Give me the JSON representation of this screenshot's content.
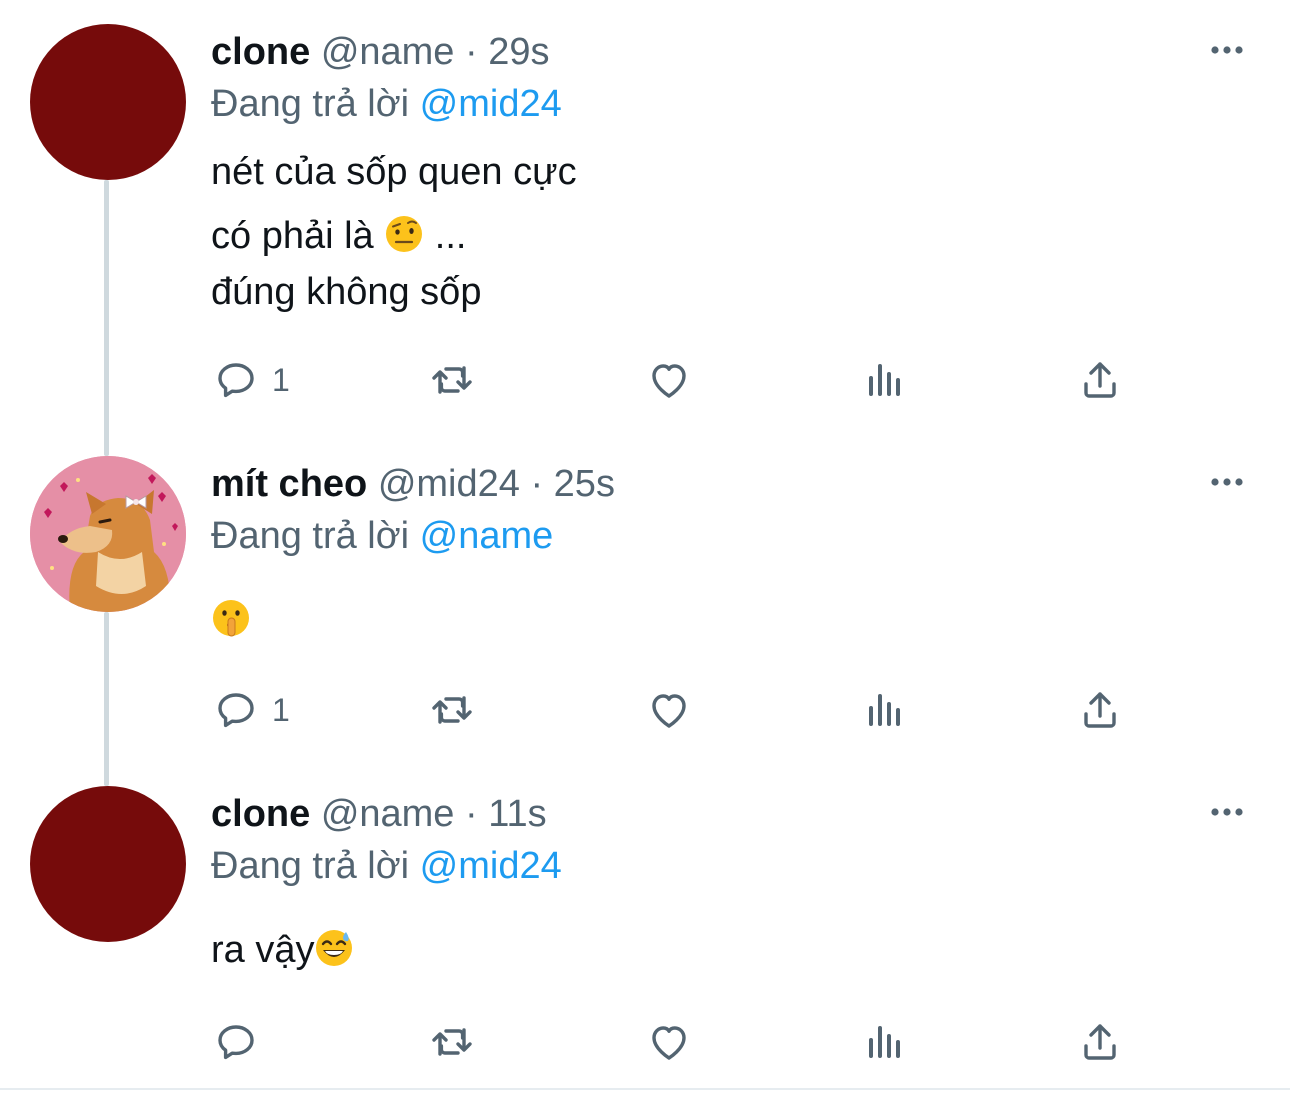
{
  "tweets": [
    {
      "name": "clone",
      "handle": "@name",
      "separator": "·",
      "time": "29s",
      "reply_prefix": "Đang trả lời",
      "reply_to": "@mid24",
      "lines": [
        "nét của sốp quen cực",
        "có phải là",
        "...",
        "đúng không sốp"
      ],
      "emoji": "raised-eyebrow-emoji",
      "reply_count": "1"
    },
    {
      "name": "mít cheo",
      "handle": "@mid24",
      "separator": "·",
      "time": "25s",
      "reply_prefix": "Đang trả lời",
      "reply_to": "@name",
      "emoji": "shushing-face-emoji",
      "reply_count": "1"
    },
    {
      "name": "clone",
      "handle": "@name",
      "separator": "·",
      "time": "11s",
      "reply_prefix": "Đang trả lời",
      "reply_to": "@mid24",
      "lines": [
        "ra vậy"
      ],
      "emoji": "grinning-sweat-emoji",
      "reply_count": ""
    }
  ],
  "icons": [
    "reply-icon",
    "retweet-icon",
    "like-icon",
    "analytics-icon",
    "share-icon",
    "more-icon"
  ],
  "colors": {
    "accent": "#1d9bf0",
    "secondary_text": "#536471",
    "avatar_red": "#760b0b",
    "thread_line": "#cfd9de"
  }
}
